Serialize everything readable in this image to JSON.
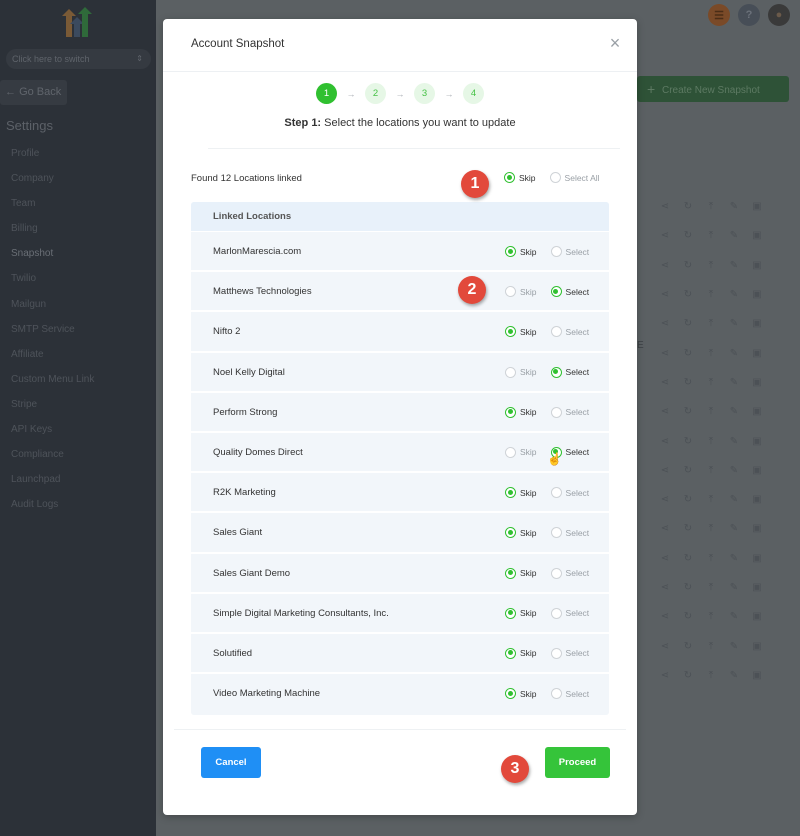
{
  "sidebar": {
    "switcher_placeholder": "Click here to switch",
    "go_back": "Go Back",
    "title": "Settings",
    "items": [
      {
        "label": "Profile"
      },
      {
        "label": "Company"
      },
      {
        "label": "Team"
      },
      {
        "label": "Billing"
      },
      {
        "label": "Snapshot",
        "active": true
      },
      {
        "label": "Twilio"
      },
      {
        "label": "Mailgun"
      },
      {
        "label": "SMTP Service"
      },
      {
        "label": "Affiliate"
      },
      {
        "label": "Custom Menu Link"
      },
      {
        "label": "Stripe"
      },
      {
        "label": "API Keys"
      },
      {
        "label": "Compliance"
      },
      {
        "label": "Launchpad"
      },
      {
        "label": "Audit Logs"
      }
    ]
  },
  "header": {
    "icons": [
      "menu-icon",
      "help-icon",
      "user-avatar"
    ],
    "help_glyph": "?"
  },
  "background": {
    "create_button": "Create New Snapshot",
    "row_action_icons": [
      "share-icon",
      "refresh-icon",
      "upload-icon",
      "edit-icon",
      "delete-icon"
    ],
    "row_count": 17,
    "partial_text": "E"
  },
  "modal": {
    "title": "Account Snapshot",
    "close_glyph": "×",
    "steps": [
      "1",
      "2",
      "3",
      "4"
    ],
    "active_step": 1,
    "step_arrow": "→",
    "step_caption_bold": "Step 1:",
    "step_caption_text": " Select the locations you want to update",
    "found_label": "Found 12 Locations linked",
    "global_options": {
      "skip": "Skip",
      "select_all": "Select All",
      "selected": "skip"
    },
    "table_header": "Linked Locations",
    "option_labels": {
      "skip": "Skip",
      "select": "Select"
    },
    "locations": [
      {
        "name": "MarlonMarescia.com",
        "selected": "skip"
      },
      {
        "name": "Matthews Technologies",
        "selected": "select"
      },
      {
        "name": "Nifto 2",
        "selected": "skip"
      },
      {
        "name": "Noel Kelly Digital",
        "selected": "select"
      },
      {
        "name": "Perform Strong",
        "selected": "skip"
      },
      {
        "name": "Quality Domes Direct",
        "selected": "select"
      },
      {
        "name": "R2K Marketing",
        "selected": "skip"
      },
      {
        "name": "Sales Giant",
        "selected": "skip"
      },
      {
        "name": "Sales Giant Demo",
        "selected": "skip"
      },
      {
        "name": "Simple Digital Marketing Consultants, Inc.",
        "selected": "skip"
      },
      {
        "name": "Solutified",
        "selected": "skip"
      },
      {
        "name": "Video Marketing Machine",
        "selected": "skip"
      }
    ],
    "cancel_label": "Cancel",
    "proceed_label": "Proceed"
  },
  "annotations": [
    "1",
    "2",
    "3"
  ],
  "colors": {
    "accent_green": "#30c030",
    "cancel_blue": "#1f8ff5",
    "proceed_green": "#35c43a",
    "badge_red": "#e2493b"
  }
}
